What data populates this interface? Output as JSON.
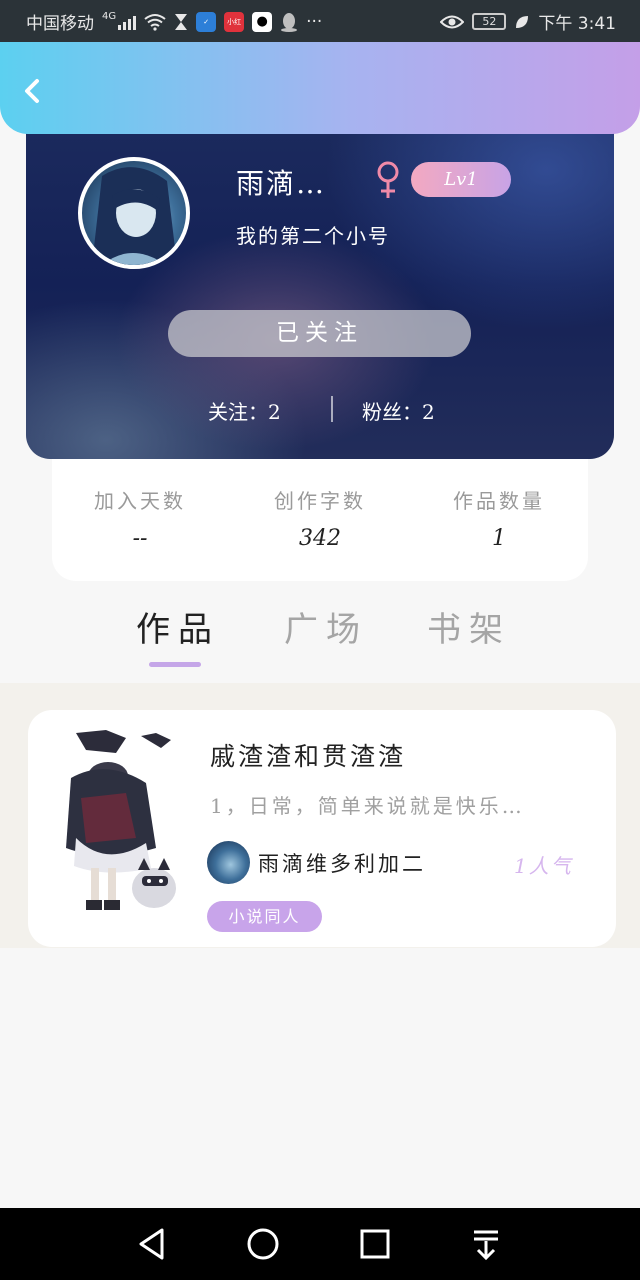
{
  "status_bar": {
    "carrier": "中国移动",
    "network": "4G",
    "app_badge": "小红书",
    "battery": "52",
    "time": "下午 3:41"
  },
  "profile": {
    "username": "雨滴…",
    "level": "Lv1",
    "bio": "我的第二个小号",
    "follow_button": "已关注",
    "following_label": "关注：",
    "following_count": "2",
    "fans_label": "粉丝：",
    "fans_count": "2"
  },
  "stats": [
    {
      "label": "加入天数",
      "value": "--"
    },
    {
      "label": "创作字数",
      "value": "342"
    },
    {
      "label": "作品数量",
      "value": "1"
    }
  ],
  "tabs": [
    {
      "label": "作品",
      "active": true
    },
    {
      "label": "广场",
      "active": false
    },
    {
      "label": "书架",
      "active": false
    }
  ],
  "works": [
    {
      "title": "戚渣渣和贯渣渣",
      "description": "1，日常，简单来说就是快乐…",
      "author": "雨滴维多利加二",
      "popularity": "1人气",
      "tag": "小说同人"
    }
  ],
  "colors": {
    "accent": "#c5a6e8",
    "header_start": "#5cd0f0",
    "header_end": "#c49fe8",
    "banner": "#1a2658",
    "gender_female": "#f08aa8"
  }
}
